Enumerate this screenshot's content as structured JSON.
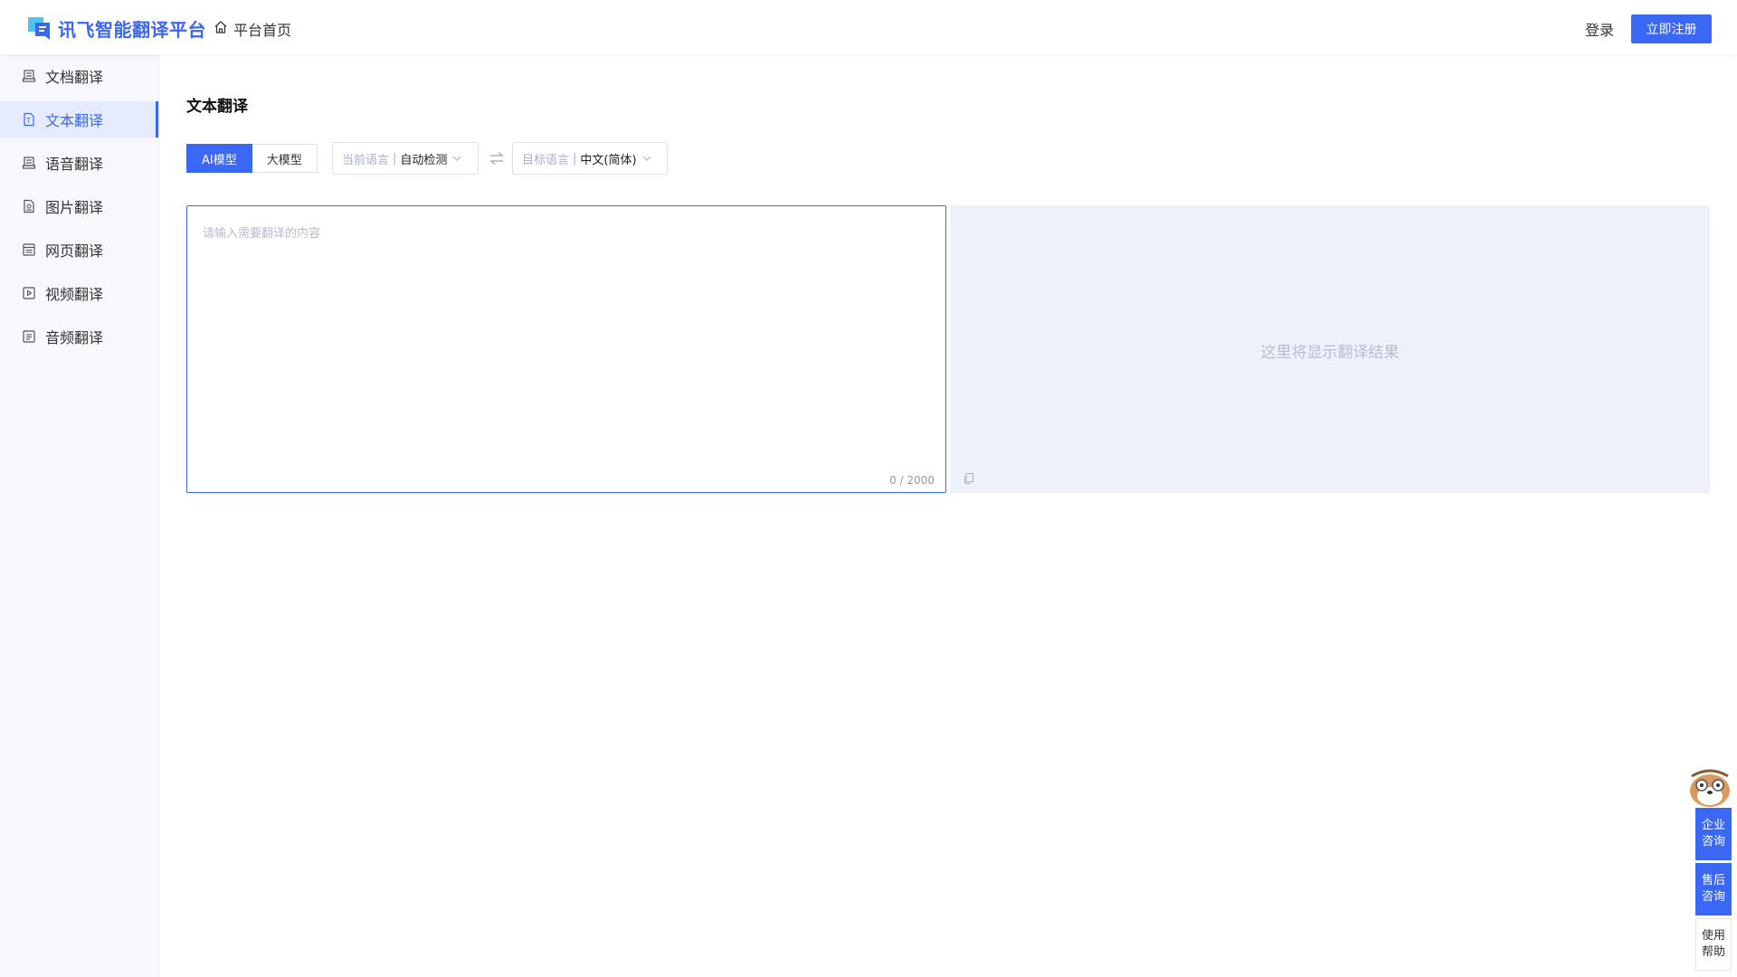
{
  "header": {
    "logo_text": "讯飞智能翻译平台",
    "home_label": "平台首页",
    "login_label": "登录",
    "register_label": "立即注册"
  },
  "sidebar": {
    "items": [
      {
        "label": "文档翻译",
        "icon": "document-translate-icon",
        "active": false
      },
      {
        "label": "文本翻译",
        "icon": "text-translate-icon",
        "active": true
      },
      {
        "label": "语音翻译",
        "icon": "voice-translate-icon",
        "active": false
      },
      {
        "label": "图片翻译",
        "icon": "image-translate-icon",
        "active": false
      },
      {
        "label": "网页翻译",
        "icon": "web-translate-icon",
        "active": false
      },
      {
        "label": "视频翻译",
        "icon": "video-translate-icon",
        "active": false
      },
      {
        "label": "音频翻译",
        "icon": "audio-translate-icon",
        "active": false
      }
    ]
  },
  "main": {
    "title": "文本翻译",
    "model_tabs": [
      {
        "label": "AI模型",
        "active": true
      },
      {
        "label": "大模型",
        "active": false
      }
    ],
    "source_lang": {
      "label": "当前语言",
      "value": "自动检测"
    },
    "target_lang": {
      "label": "目标语言",
      "value": "中文(简体)"
    },
    "input": {
      "placeholder": "请输入需要翻译的内容",
      "value": "",
      "counter": "0 / 2000"
    },
    "output": {
      "placeholder": "这里将显示翻译结果"
    }
  },
  "float_buttons": [
    {
      "label": "企业咨询"
    },
    {
      "label": "售后咨询"
    },
    {
      "label": "使用帮助"
    }
  ],
  "colors": {
    "accent": "#3b67f5",
    "sidebar_bg": "#f7f8fc",
    "output_bg": "#eef1fa"
  }
}
